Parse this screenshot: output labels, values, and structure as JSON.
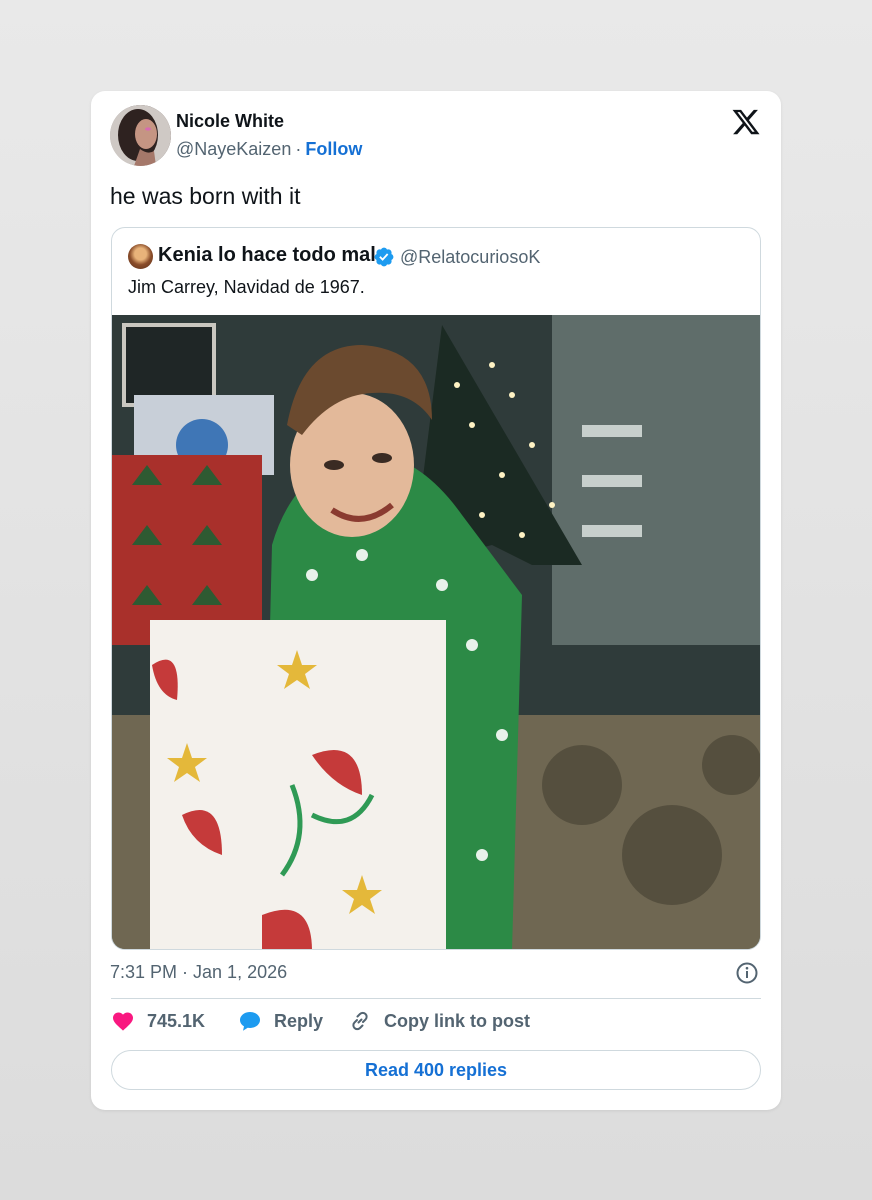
{
  "tweet": {
    "author": {
      "name": "Nicole White",
      "handle": "@NayeKaizen",
      "separator": "·",
      "follow_label": "Follow"
    },
    "text": "he was born with it",
    "timestamp": "7:31 PM · Jan 1, 2026"
  },
  "quoted_tweet": {
    "author_name": "Kenia lo hace todo mal",
    "verified": true,
    "handle": "@RelatocuriosoK",
    "text": "Jim Carrey, Navidad de 1967."
  },
  "actions": {
    "like_count": "745.1K",
    "reply_label": "Reply",
    "copy_label": "Copy link to post"
  },
  "read_replies_label": "Read 400 replies",
  "colors": {
    "accent": "#1570d4",
    "like": "#f91880",
    "reply_icon": "#1d9bf0",
    "verified": "#1d9bf0",
    "muted_text": "#536471"
  },
  "icons": {
    "brand": "x-logo-icon",
    "verified": "verified-badge-icon",
    "info": "info-icon",
    "like": "heart-icon",
    "reply": "speech-bubble-icon",
    "copy": "link-icon"
  }
}
